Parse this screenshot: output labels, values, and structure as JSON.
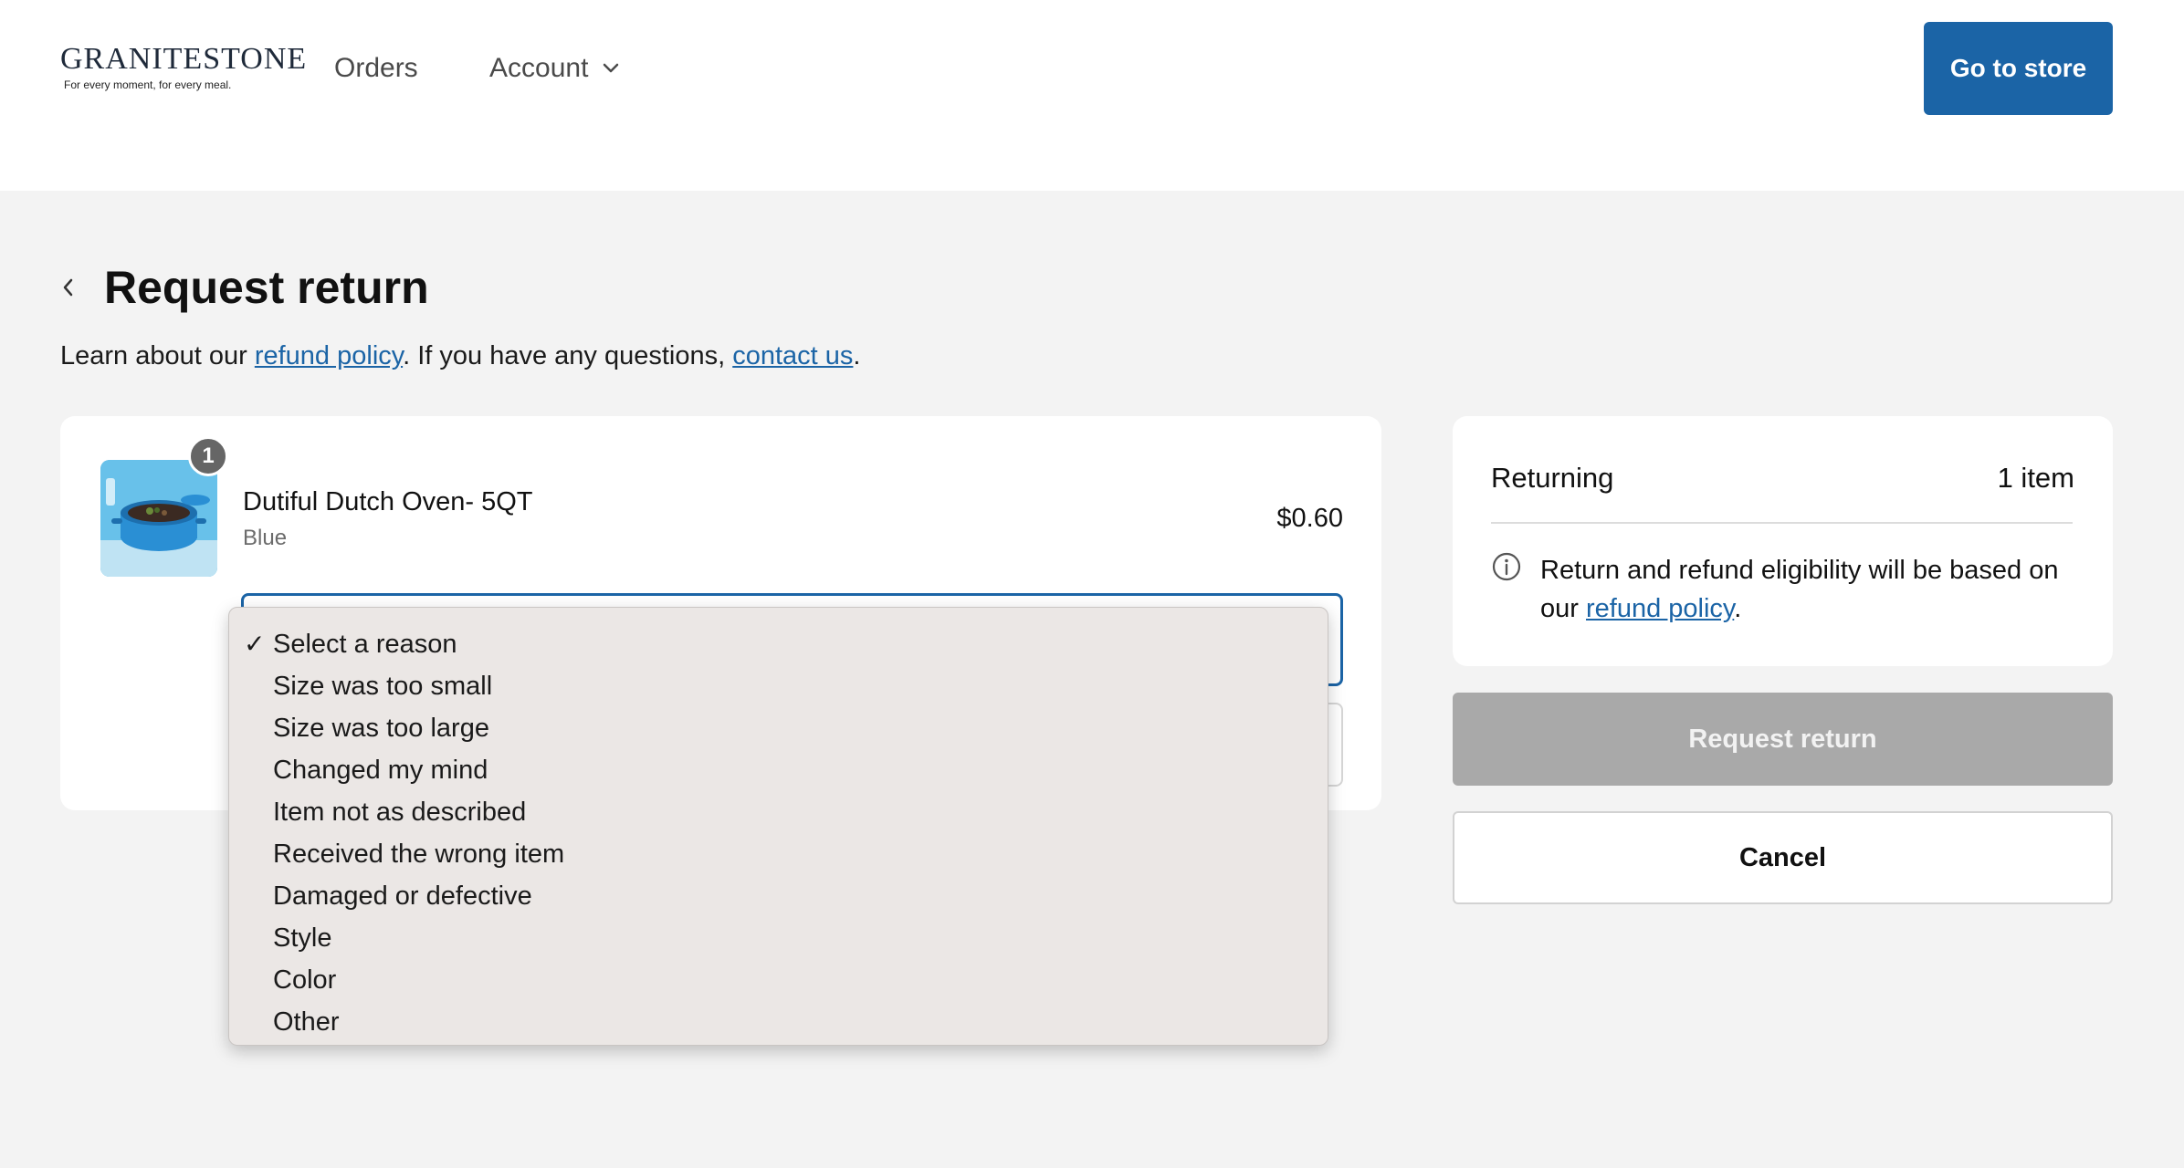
{
  "header": {
    "logo": {
      "wordmark": "GRANITESTONE",
      "tagline": "For every moment, for every meal."
    },
    "nav": [
      {
        "label": "Orders"
      },
      {
        "label": "Account"
      }
    ],
    "store_button": "Go to store"
  },
  "page": {
    "title": "Request return",
    "subtitle": {
      "prefix": "Learn about our ",
      "refund_link": "refund policy",
      "middle": ". If you have any questions, ",
      "contact_link": "contact us",
      "suffix": "."
    }
  },
  "item": {
    "name": "Dutiful Dutch Oven- 5QT",
    "variant": "Blue",
    "price": "$0.60",
    "quantity_badge": "1"
  },
  "reason_dropdown": {
    "selected_index": 0,
    "check_glyph": "✓",
    "options": [
      "Select a reason",
      "Size was too small",
      "Size was too large",
      "Changed my mind",
      "Item not as described",
      "Received the wrong item",
      "Damaged or defective",
      "Style",
      "Color",
      "Other"
    ]
  },
  "summary": {
    "label": "Returning",
    "value": "1 item",
    "note_prefix": "Return and refund eligibility will be based on our ",
    "note_link": "refund policy",
    "note_suffix": "."
  },
  "actions": {
    "submit": "Request return",
    "cancel": "Cancel"
  },
  "colors": {
    "accent": "#1b64a6",
    "disabled": "#a9a9a9",
    "page_bg": "#f3f3f3"
  },
  "icons": {
    "account_chevron": "chevron-down-icon",
    "back": "chevron-left-icon",
    "info": "info-icon",
    "check": "checkmark-icon"
  }
}
